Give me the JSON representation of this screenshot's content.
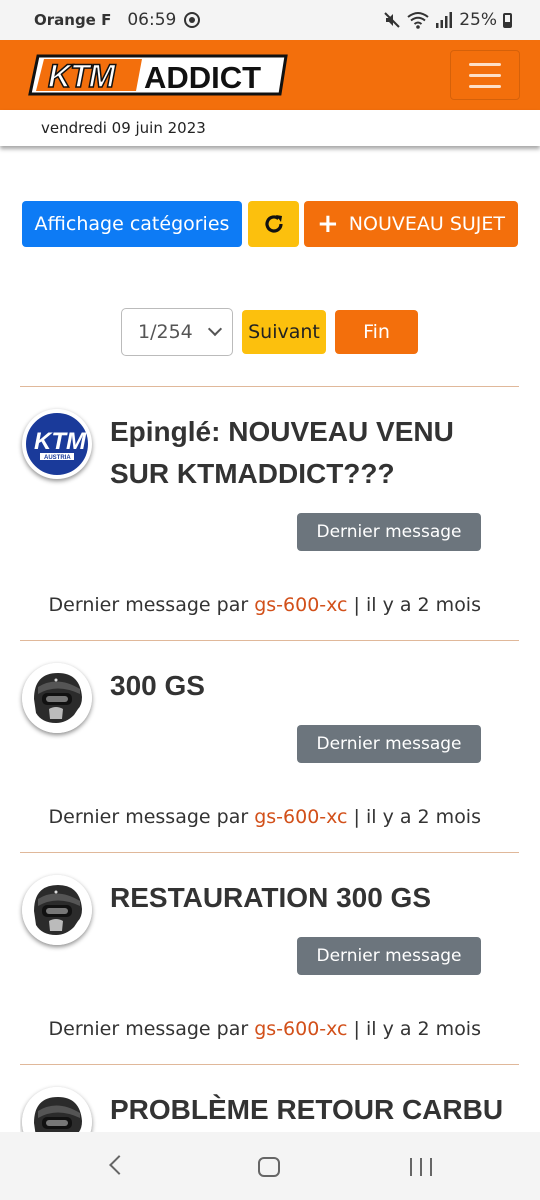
{
  "status_bar": {
    "carrier": "Orange F",
    "time": "06:59",
    "battery": "25%"
  },
  "header": {
    "logo_text": "KTMADDICT",
    "date": "vendredi 09 juin 2023"
  },
  "actions": {
    "categories_label": "Affichage catégories",
    "new_topic_label": "NOUVEAU SUJET"
  },
  "pagination": {
    "current": "1/254",
    "next_label": "Suivant",
    "end_label": "Fin"
  },
  "topics": [
    {
      "title": "Epinglé: NOUVEAU VENU SUR KTMADDICT???",
      "avatar": "ktm-austria-logo",
      "button_label": "Dernier message",
      "last_prefix": "Dernier message par",
      "last_user": "gs-600-xc",
      "last_suffix": "| il y a 2 mois"
    },
    {
      "title": "300 GS",
      "avatar": "helmet-rider",
      "button_label": "Dernier message",
      "last_prefix": "Dernier message par",
      "last_user": "gs-600-xc",
      "last_suffix": "| il y a 2 mois"
    },
    {
      "title": "RESTAURATION 300 GS",
      "avatar": "helmet-rider",
      "button_label": "Dernier message",
      "last_prefix": "Dernier message par",
      "last_user": "gs-600-xc",
      "last_suffix": "| il y a 2 mois"
    },
    {
      "title": "PROBLÈME RETOUR CARBU",
      "avatar": "helmet-rider"
    }
  ],
  "colors": {
    "brand_orange": "#f36f0c",
    "primary_blue": "#0d7bf5",
    "warning_yellow": "#fcc00d",
    "secondary_gray": "#6c757d",
    "link_orange": "#d2501a"
  }
}
